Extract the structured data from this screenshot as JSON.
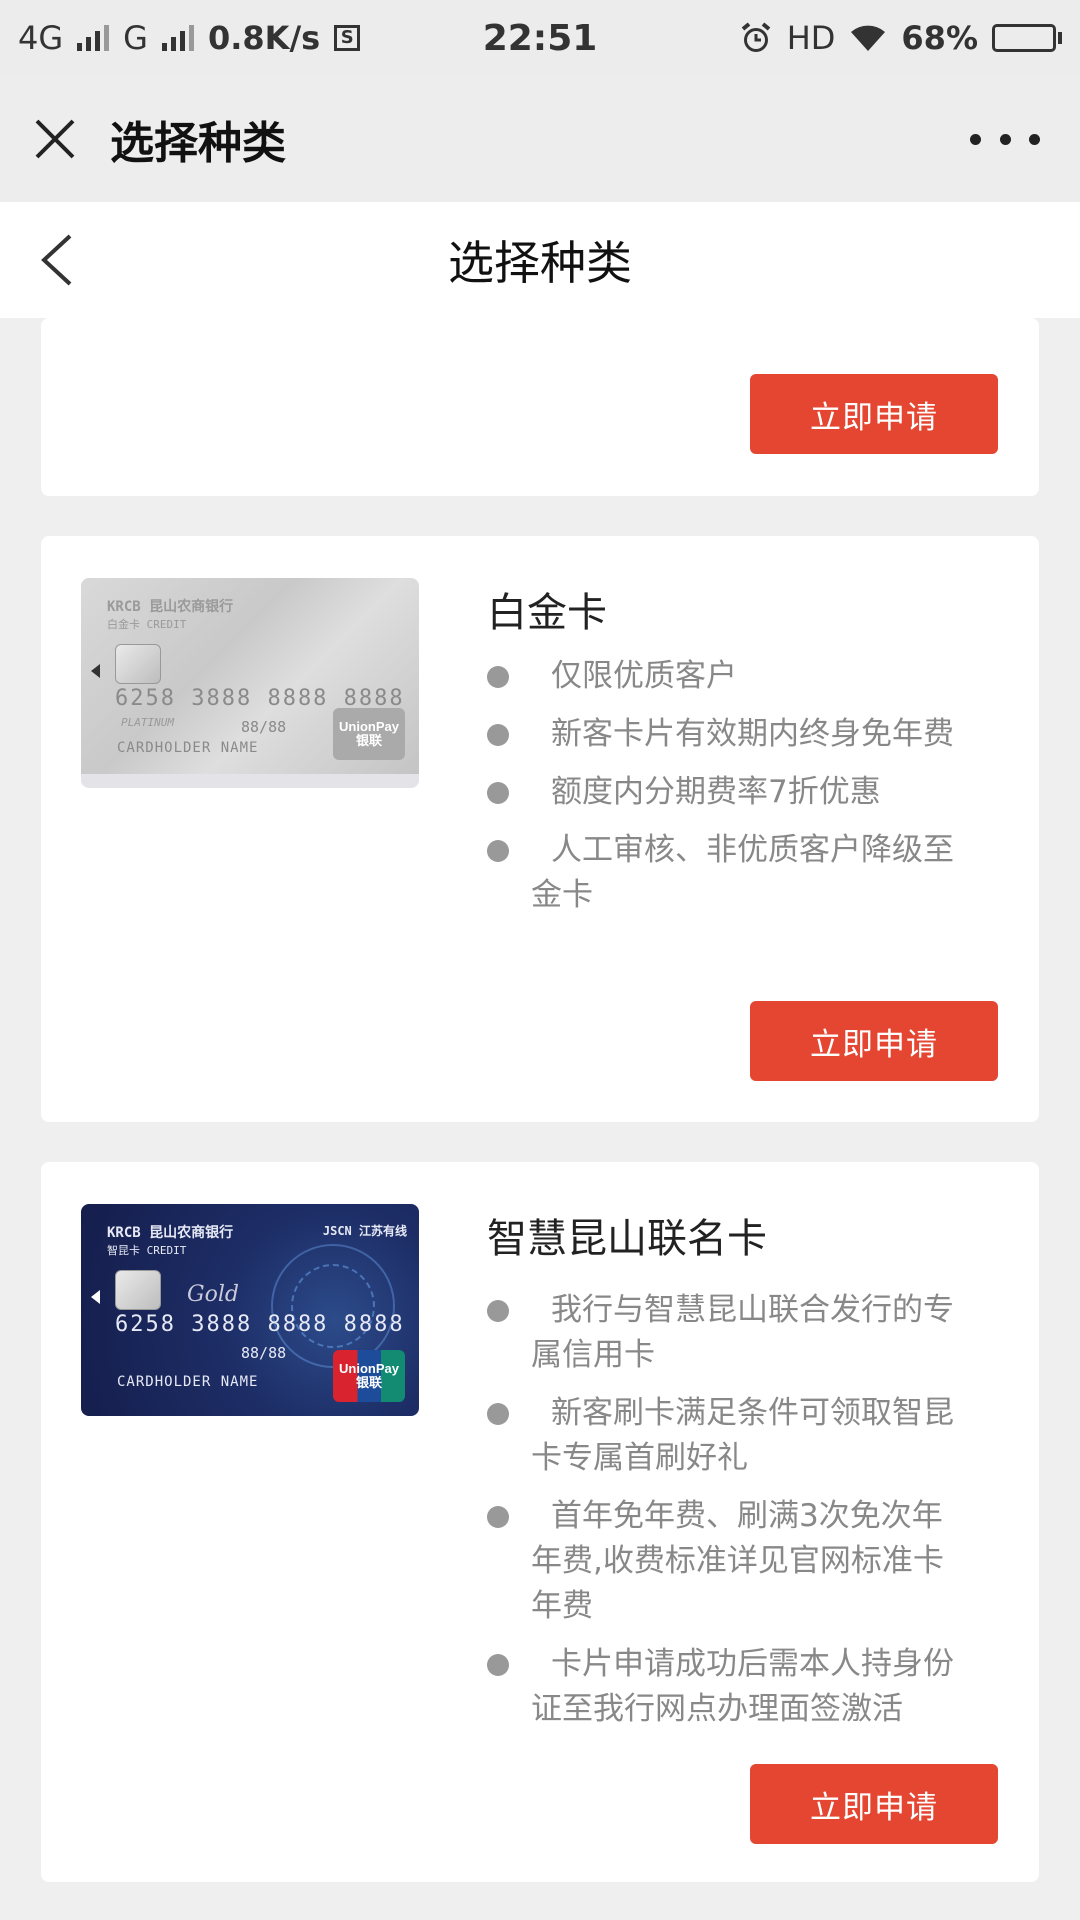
{
  "status_bar": {
    "network_left": "4G",
    "network_mid": "G",
    "speed": "0.8K/s",
    "s_icon": "S",
    "time": "22:51",
    "hd": "HD",
    "battery_percent": "68%",
    "battery_level": 0.68
  },
  "wechat_bar": {
    "title": "选择种类"
  },
  "page_header": {
    "title": "选择种类"
  },
  "cards": [
    {
      "apply_label": "立即申请"
    },
    {
      "name": "白金卡",
      "features": [
        "仅限优质客户",
        "新客卡片有效期内终身免年费",
        "额度内分期费率7折优惠",
        "人工审核、非优质客户降级至金卡"
      ],
      "apply_label": "立即申请",
      "image": {
        "bank": "KRCB 昆山农商银行",
        "credit": "白金卡  CREDIT",
        "number": "6258 3888 8888 8888",
        "tier": "PLATINUM",
        "valid": "88/88",
        "holder": "CARDHOLDER NAME",
        "unionpay": "UnionPay 银联"
      }
    },
    {
      "name": "智慧昆山联名卡",
      "features": [
        "我行与智慧昆山联合发行的专属信用卡",
        "新客刷卡满足条件可领取智昆卡专属首刷好礼",
        "首年免年费、刷满3次免次年年费,收费标准详见官网标准卡年费",
        "卡片申请成功后需本人持身份证至我行网点办理面签激活"
      ],
      "apply_label": "立即申请",
      "image": {
        "bank": "KRCB 昆山农商银行",
        "partner": "JSCN 江苏有线",
        "credit": "智昆卡  CREDIT",
        "tier": "Gold",
        "number": "6258 3888 8888 8888",
        "valid": "88/88",
        "holder": "CARDHOLDER NAME",
        "unionpay": "UnionPay 银联"
      }
    }
  ],
  "colors": {
    "accent": "#e44632",
    "background": "#efefef"
  }
}
